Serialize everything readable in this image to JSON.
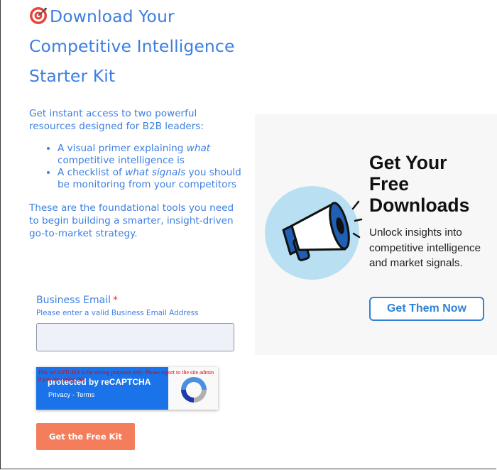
{
  "title": {
    "emoji_icon": "target-icon",
    "line1": "Download Your",
    "line2": "Competitive Intelligence",
    "line3": "Starter Kit"
  },
  "intro": "Get instant access to two powerful resources designed for B2B leaders:",
  "bullets": [
    {
      "pre": "A visual primer explaining ",
      "em": "what",
      "post": " competitive intelligence is"
    },
    {
      "pre": "A checklist of ",
      "em": "what signals",
      "post": " you should be monitoring from your competitors"
    }
  ],
  "closing": "These are the foundational tools you need to begin building a smarter, insight-driven go-to-market strategy.",
  "form": {
    "email_label": "Business Email",
    "required_mark": "*",
    "email_hint": "Please enter a valid Business Email Address",
    "email_value": "",
    "submit_label": "Get the Free Kit"
  },
  "recaptcha": {
    "protected_text": "protected by reCAPTCHA",
    "links_text": "Privacy - Terms",
    "warning_text": "This reCAPTCHA is for testing purposes only. Please report to the site admin if you are seeing this."
  },
  "promo": {
    "headline_line1": "Get Your",
    "headline_line2": "Free",
    "headline_line3": "Downloads",
    "subtext": "Unlock insights into competitive intelligence and market signals.",
    "button_label": "Get Them Now",
    "icon": "megaphone-icon"
  },
  "colors": {
    "accent_blue": "#3d7fe0",
    "submit_orange": "#f47e5b",
    "promo_blue": "#2f82d6"
  }
}
